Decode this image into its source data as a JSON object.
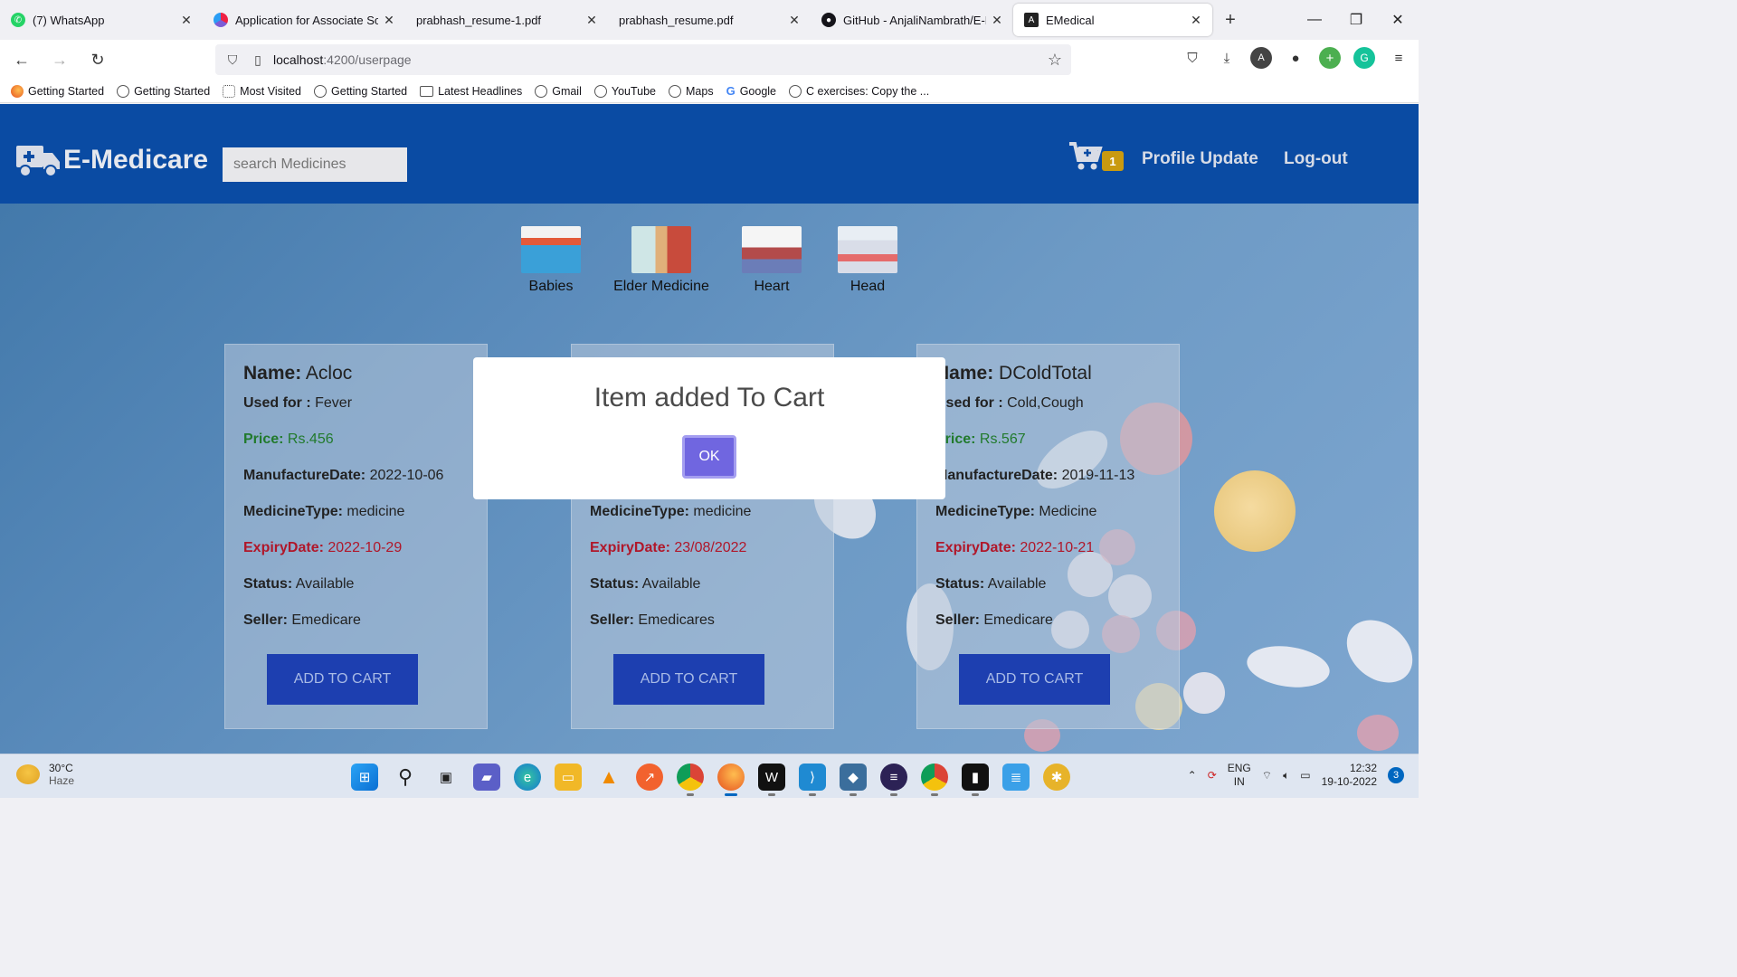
{
  "browser": {
    "tabs": [
      {
        "title": "(7) WhatsApp",
        "favicon_color": "#25d366",
        "active": false
      },
      {
        "title": "Application for Associate Softw",
        "favicon_color": "#7b5cd6",
        "active": false
      },
      {
        "title": "prabhash_resume-1.pdf",
        "favicon_color": "",
        "active": false
      },
      {
        "title": "prabhash_resume.pdf",
        "favicon_color": "",
        "active": false
      },
      {
        "title": "GitHub - AnjaliNambrath/E-Me",
        "favicon_color": "#15141a",
        "active": false
      },
      {
        "title": "EMedical",
        "favicon_color": "#222222",
        "active": true
      }
    ],
    "url_host": "localhost",
    "url_path": ":4200/userpage",
    "bookmarks": [
      {
        "label": "Getting Started",
        "icon": "firefox-icon"
      },
      {
        "label": "Getting Started",
        "icon": "globe-icon"
      },
      {
        "label": "Most Visited",
        "icon": "gear-icon"
      },
      {
        "label": "Getting Started",
        "icon": "globe-icon"
      },
      {
        "label": "Latest Headlines",
        "icon": "folder-icon"
      },
      {
        "label": "Gmail",
        "icon": "globe-icon"
      },
      {
        "label": "YouTube",
        "icon": "globe-icon"
      },
      {
        "label": "Maps",
        "icon": "globe-icon"
      },
      {
        "label": "Google",
        "icon": "google-icon"
      },
      {
        "label": "C exercises: Copy the ...",
        "icon": "globe-icon"
      }
    ]
  },
  "app": {
    "brand": "E-Medicare",
    "search_placeholder": "search Medicines",
    "cart_count": "1",
    "nav": {
      "profile": "Profile Update",
      "logout": "Log-out"
    },
    "categories": [
      {
        "label": "Babies"
      },
      {
        "label": "Elder Medicine"
      },
      {
        "label": "Heart"
      },
      {
        "label": "Head"
      }
    ],
    "labels": {
      "name": "Name:",
      "used_for": "Used for :",
      "price": "Price:",
      "mfg": "ManufactureDate:",
      "type": "MedicineType:",
      "expiry": "ExpiryDate:",
      "status": "Status:",
      "seller": "Seller:",
      "add": "ADD TO CART"
    },
    "cards": [
      {
        "name": "Acloc",
        "used_for": "Fever",
        "price": "Rs.456",
        "mfg": "2022-10-06",
        "type": "medicine",
        "expiry": "2022-10-29",
        "status": "Available",
        "seller": "Emedicare"
      },
      {
        "name": "",
        "used_for": "",
        "price": "",
        "mfg": "",
        "type": "medicine",
        "expiry": "23/08/2022",
        "status": "Available",
        "seller": "Emedicares"
      },
      {
        "name": "DColdTotal",
        "used_for": "Cold,Cough",
        "price": "Rs.567",
        "mfg": "2019-11-13",
        "type": "Medicine",
        "expiry": "2022-10-21",
        "status": "Available",
        "seller": "Emedicare"
      }
    ],
    "dialog": {
      "message": "Item added To Cart",
      "ok": "OK"
    }
  },
  "taskbar": {
    "weather_temp": "30°C",
    "weather_desc": "Haze",
    "lang_1": "ENG",
    "lang_2": "IN",
    "time": "12:32",
    "date": "19-10-2022",
    "notifications": "3"
  }
}
